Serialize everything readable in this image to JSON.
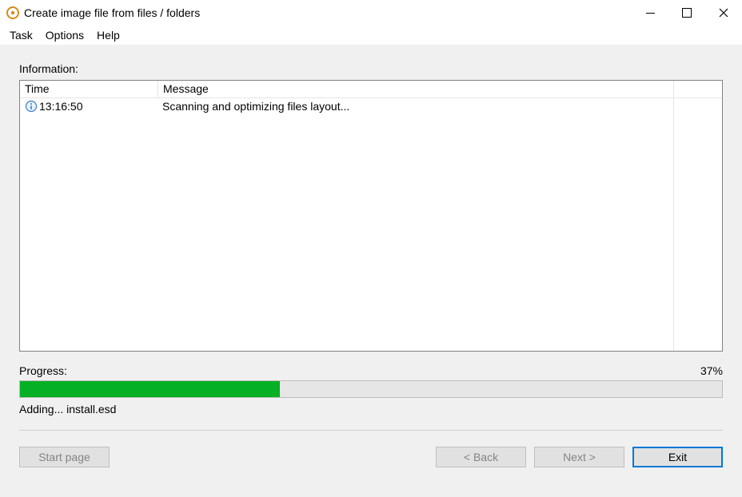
{
  "window": {
    "title": "Create image file from files / folders"
  },
  "menu": {
    "task": "Task",
    "options": "Options",
    "help": "Help"
  },
  "info": {
    "label": "Information:",
    "columns": {
      "time": "Time",
      "message": "Message"
    },
    "rows": [
      {
        "time": "13:16:50",
        "message": "Scanning and optimizing files layout..."
      }
    ]
  },
  "progress": {
    "label": "Progress:",
    "percent_text": "37%",
    "percent_value": 37,
    "status": "Adding...  install.esd"
  },
  "buttons": {
    "startpage": "Start page",
    "back": "< Back",
    "next": "Next >",
    "exit": "Exit"
  }
}
